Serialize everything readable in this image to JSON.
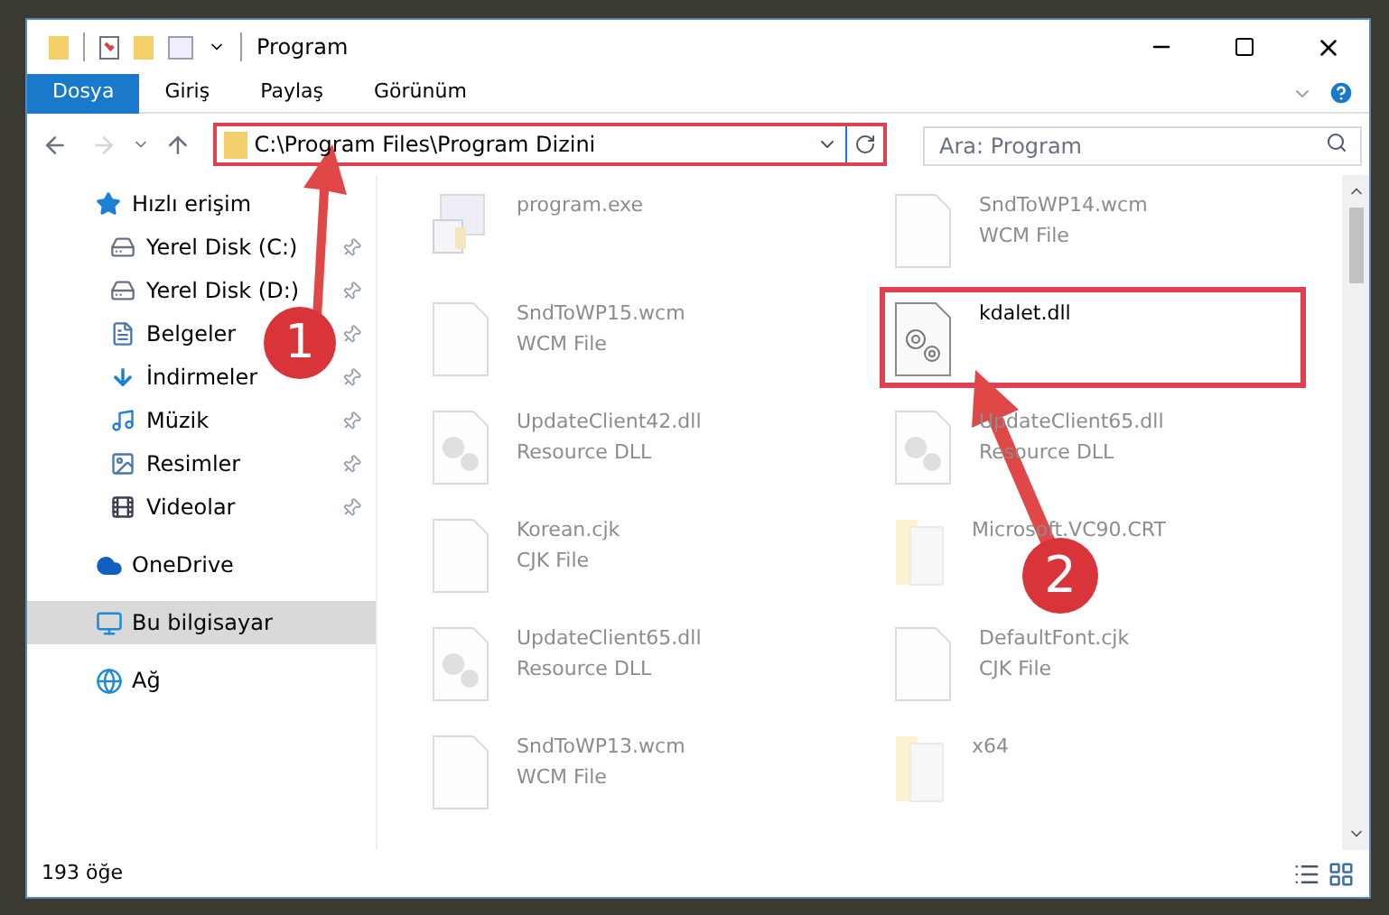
{
  "window": {
    "title": "Program"
  },
  "ribbon_tabs": [
    {
      "label": "Dosya",
      "selected": true
    },
    {
      "label": "Giriş",
      "selected": false
    },
    {
      "label": "Paylaş",
      "selected": false
    },
    {
      "label": "Görünüm",
      "selected": false
    }
  ],
  "address": {
    "path": "C:\\Program Files\\Program Dizini"
  },
  "search": {
    "placeholder": "Ara: Program"
  },
  "sidebar": {
    "items": [
      {
        "label": "Hızlı erişim",
        "kind": "star",
        "selected": false,
        "children": [
          {
            "label": "Yerel Disk (C:)",
            "kind": "drive",
            "pinned": true,
            "selected": false
          },
          {
            "label": "Yerel Disk (D:)",
            "kind": "drive",
            "pinned": true,
            "selected": false
          },
          {
            "label": "Belgeler",
            "kind": "docs",
            "pinned": true,
            "selected": false
          },
          {
            "label": "İndirmeler",
            "kind": "download",
            "pinned": true,
            "selected": false
          },
          {
            "label": "Müzik",
            "kind": "music",
            "pinned": true,
            "selected": false
          },
          {
            "label": "Resimler",
            "kind": "pictures",
            "pinned": true,
            "selected": false
          },
          {
            "label": "Videolar",
            "kind": "videos",
            "pinned": true,
            "selected": false
          }
        ]
      },
      {
        "label": "OneDrive",
        "kind": "cloud",
        "selected": false
      },
      {
        "label": "Bu bilgisayar",
        "kind": "computer",
        "selected": true
      },
      {
        "label": "Ağ",
        "kind": "network",
        "selected": false
      }
    ]
  },
  "files": [
    {
      "name": "program.exe",
      "kind": "exe",
      "selected": false
    },
    {
      "name": "SndToWP14.wcm",
      "type": "WCM File",
      "kind": "doc",
      "selected": false
    },
    {
      "name": "SndToWP15.wcm",
      "type": "WCM File",
      "kind": "doc",
      "selected": false
    },
    {
      "name": "kdalet.dll",
      "kind": "gear",
      "selected": true
    },
    {
      "name": "UpdateClient42.dll",
      "type": "Resource DLL",
      "kind": "dll",
      "selected": false
    },
    {
      "name": "UpdateClient65.dll",
      "type": "Resource DLL",
      "kind": "dll",
      "selected": false
    },
    {
      "name": "Korean.cjk",
      "type": "CJK File",
      "kind": "doc",
      "selected": false
    },
    {
      "name": "Microsoft.VC90.CRT",
      "kind": "folder",
      "selected": false
    },
    {
      "name": "UpdateClient65.dll",
      "type": "Resource DLL",
      "kind": "dll",
      "selected": false
    },
    {
      "name": "DefaultFont.cjk",
      "type": "CJK File",
      "kind": "doc",
      "selected": false
    },
    {
      "name": "SndToWP13.wcm",
      "type": "WCM File",
      "kind": "doc",
      "selected": false
    },
    {
      "name": "x64",
      "kind": "folder",
      "selected": false
    }
  ],
  "status_bar": {
    "count": "193 öğe"
  },
  "annotations": [
    {
      "label": "1"
    },
    {
      "label": "2"
    }
  ]
}
